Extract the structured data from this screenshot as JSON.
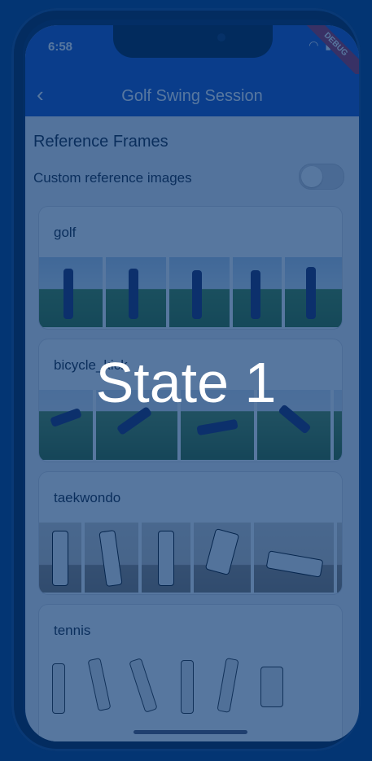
{
  "status": {
    "time": "6:58",
    "debug": "DEBUG",
    "icons": "wifi battery"
  },
  "appbar": {
    "back_icon": "‹",
    "title": "Golf Swing Session"
  },
  "reference": {
    "section_title": "Reference Frames",
    "toggle_label": "Custom reference images",
    "toggle_on": false
  },
  "cards": [
    {
      "title": "golf"
    },
    {
      "title": "bicycle_kick"
    },
    {
      "title": "taekwondo"
    },
    {
      "title": "tennis"
    }
  ],
  "overlay": {
    "label": "State 1"
  },
  "colors": {
    "primary": "#1e55c4",
    "overlay": "#00316e",
    "debug": "#a33355"
  }
}
